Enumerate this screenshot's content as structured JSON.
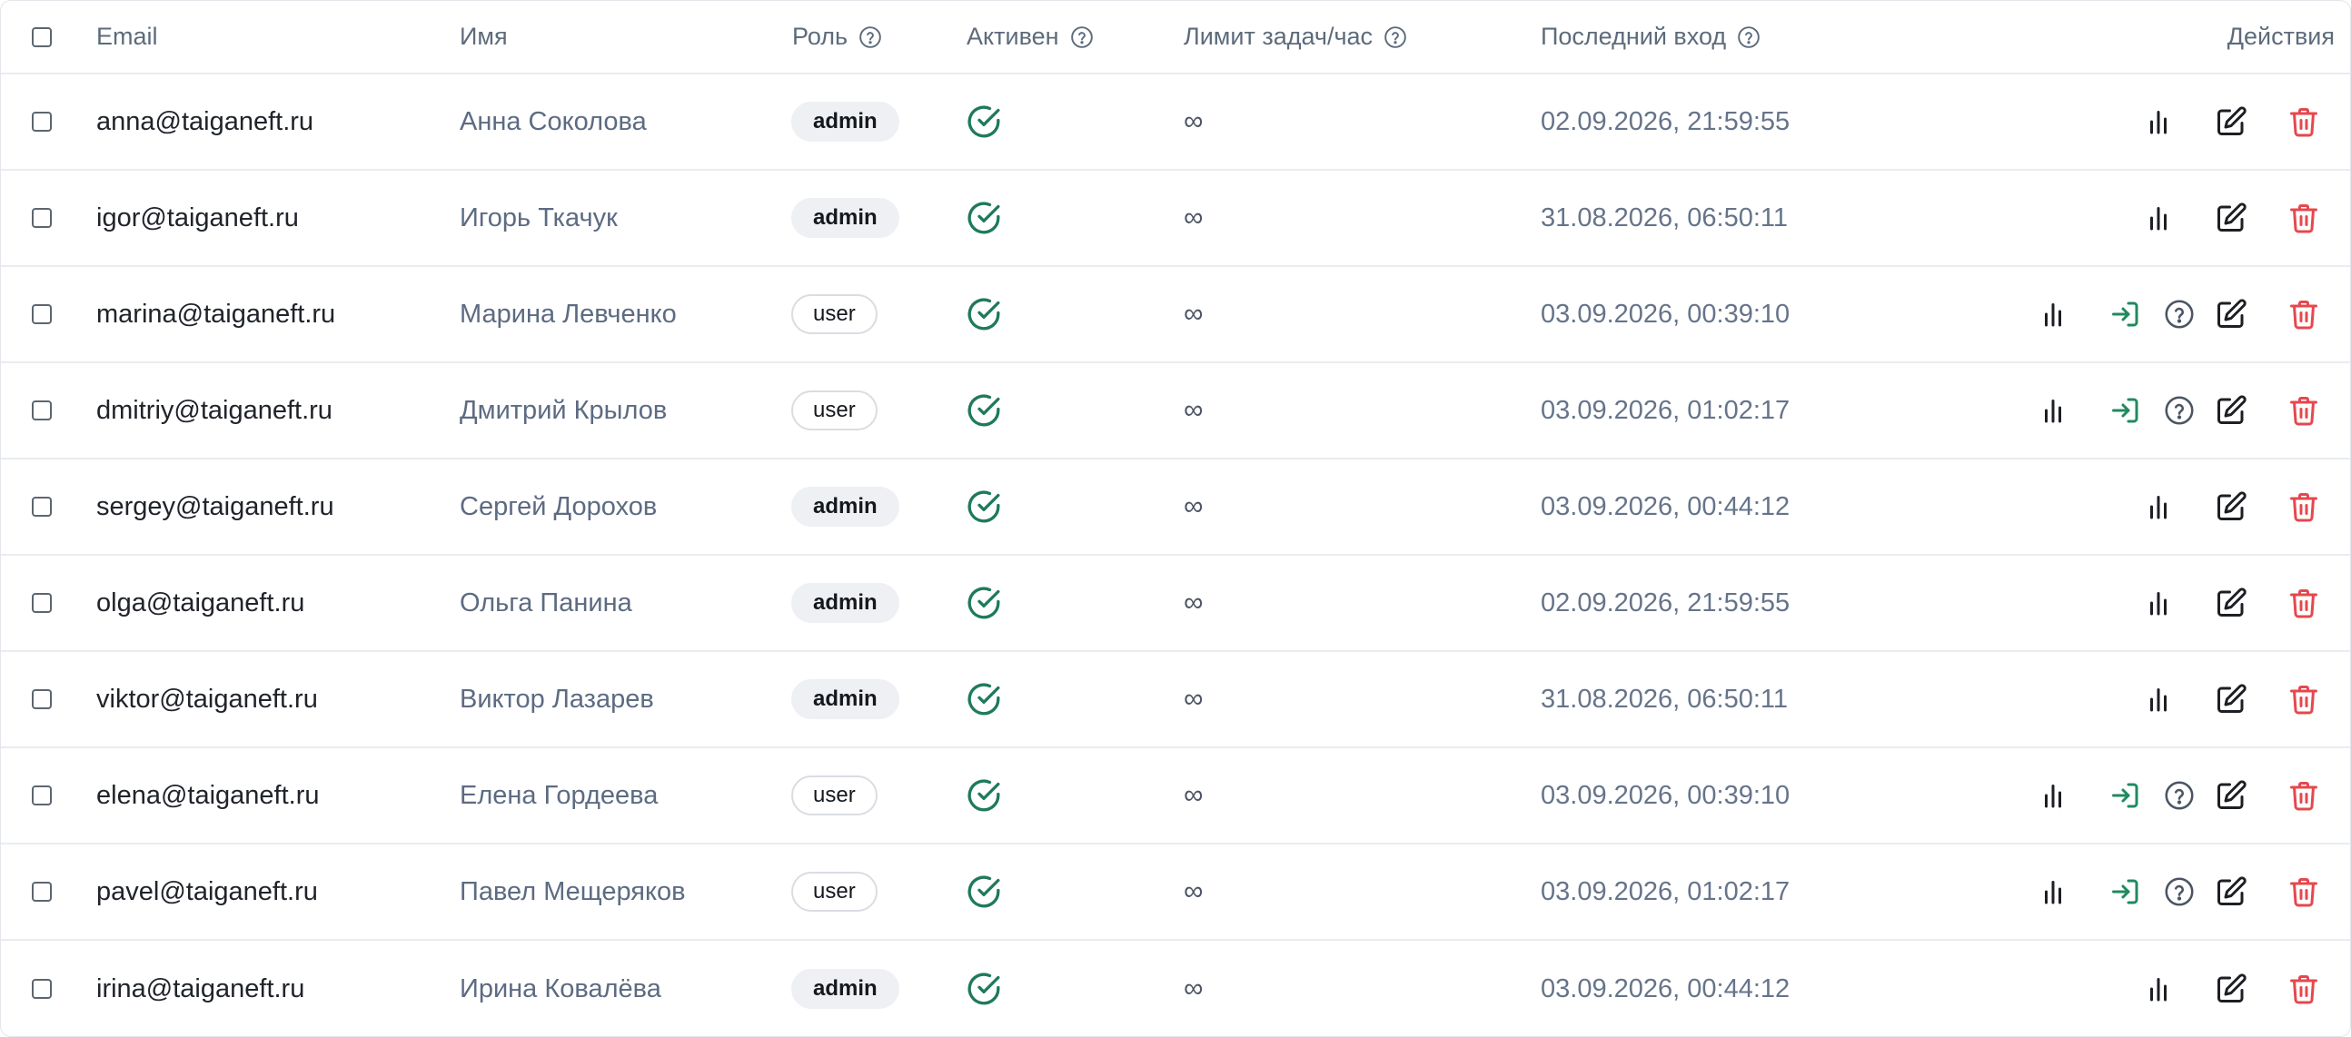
{
  "table": {
    "headers": {
      "email": "Email",
      "name": "Имя",
      "role": "Роль",
      "active": "Активен",
      "limit": "Лимит задач/час",
      "last_login": "Последний вход",
      "actions": "Действия"
    },
    "rows": [
      {
        "email": "anna@taiganeft.ru",
        "name": "Анна Соколова",
        "role": "admin",
        "active": true,
        "limit": "∞",
        "last_login": "02.09.2026, 21:59:55",
        "extra_actions": false
      },
      {
        "email": "igor@taiganeft.ru",
        "name": "Игорь Ткачук",
        "role": "admin",
        "active": true,
        "limit": "∞",
        "last_login": "31.08.2026, 06:50:11",
        "extra_actions": false
      },
      {
        "email": "marina@taiganeft.ru",
        "name": "Марина Левченко",
        "role": "user",
        "active": true,
        "limit": "∞",
        "last_login": "03.09.2026, 00:39:10",
        "extra_actions": true
      },
      {
        "email": "dmitriy@taiganeft.ru",
        "name": "Дмитрий Крылов",
        "role": "user",
        "active": true,
        "limit": "∞",
        "last_login": "03.09.2026, 01:02:17",
        "extra_actions": true
      },
      {
        "email": "sergey@taiganeft.ru",
        "name": "Сергей Дорохов",
        "role": "admin",
        "active": true,
        "limit": "∞",
        "last_login": "03.09.2026, 00:44:12",
        "extra_actions": false
      },
      {
        "email": "olga@taiganeft.ru",
        "name": "Ольга Панина",
        "role": "admin",
        "active": true,
        "limit": "∞",
        "last_login": "02.09.2026, 21:59:55",
        "extra_actions": false
      },
      {
        "email": "viktor@taiganeft.ru",
        "name": "Виктор Лазарев",
        "role": "admin",
        "active": true,
        "limit": "∞",
        "last_login": "31.08.2026, 06:50:11",
        "extra_actions": false
      },
      {
        "email": "elena@taiganeft.ru",
        "name": "Елена Гордеева",
        "role": "user",
        "active": true,
        "limit": "∞",
        "last_login": "03.09.2026, 00:39:10",
        "extra_actions": true
      },
      {
        "email": "pavel@taiganeft.ru",
        "name": "Павел Мещеряков",
        "role": "user",
        "active": true,
        "limit": "∞",
        "last_login": "03.09.2026, 01:02:17",
        "extra_actions": true
      },
      {
        "email": "irina@taiganeft.ru",
        "name": "Ирина Ковалёва",
        "role": "admin",
        "active": true,
        "limit": "∞",
        "last_login": "03.09.2026, 00:44:12",
        "extra_actions": false
      }
    ]
  },
  "icons": {
    "help": "help-circle-icon",
    "active": "check-circle-icon",
    "stats": "bar-chart-icon",
    "login_as": "login-arrow-icon",
    "info": "help-circle-icon",
    "edit": "edit-icon",
    "delete": "trash-icon"
  },
  "colors": {
    "active_check": "#1f7a5a",
    "login_icon": "#1f8a5e",
    "delete_icon": "#e5484d",
    "text_primary": "#20242a",
    "text_secondary": "#5d6b82"
  }
}
